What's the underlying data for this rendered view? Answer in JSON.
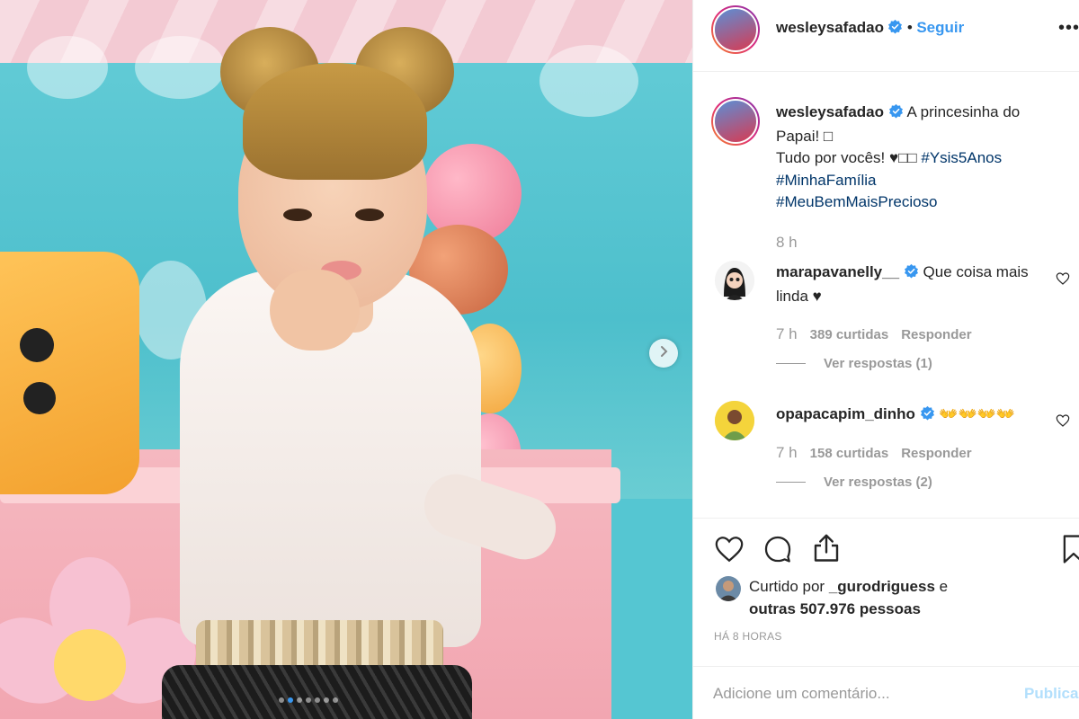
{
  "post": {
    "author": "wesleysafadao",
    "follow_label": "Seguir",
    "separator": "•",
    "more_label": "•••",
    "caption_line1": "A princesinha do",
    "caption_line2": "Papai! □",
    "caption_line3": "Tudo por vocês! ♥□□",
    "hashtags": [
      "#Ysis5Anos",
      "#MinhaFamília",
      "#MeuBemMaisPrecioso"
    ],
    "caption_time": "8 h"
  },
  "comments": [
    {
      "username": "marapavanelly__",
      "text": "Que coisa mais linda ♥",
      "time": "7 h",
      "likes": "389 curtidas",
      "reply_label": "Responder",
      "view_replies": "Ver respostas (1)"
    },
    {
      "username": "opapacapim_dinho",
      "text": "👐👐👐👐",
      "time": "7 h",
      "likes": "158 curtidas",
      "reply_label": "Responder",
      "view_replies": "Ver respostas (2)"
    }
  ],
  "likes": {
    "prefix": "Curtido por",
    "user": "_gurodriguess",
    "conj": "e",
    "others": "outras 507.976 pessoas"
  },
  "posted_ago": "HÁ 8 HORAS",
  "comment_box": {
    "placeholder": "Adicione um comentário...",
    "publish_label": "Publicar"
  },
  "carousel": {
    "total_slides": 7,
    "active_slide": 2
  },
  "colors": {
    "link": "#3897f0",
    "hashtag": "#003569",
    "muted": "#999999",
    "publish_disabled": "#b2dffc"
  },
  "icons": [
    "verified-badge-icon",
    "chevron-right-icon",
    "heart-icon",
    "comment-icon",
    "share-icon",
    "bookmark-icon",
    "more-icon"
  ]
}
